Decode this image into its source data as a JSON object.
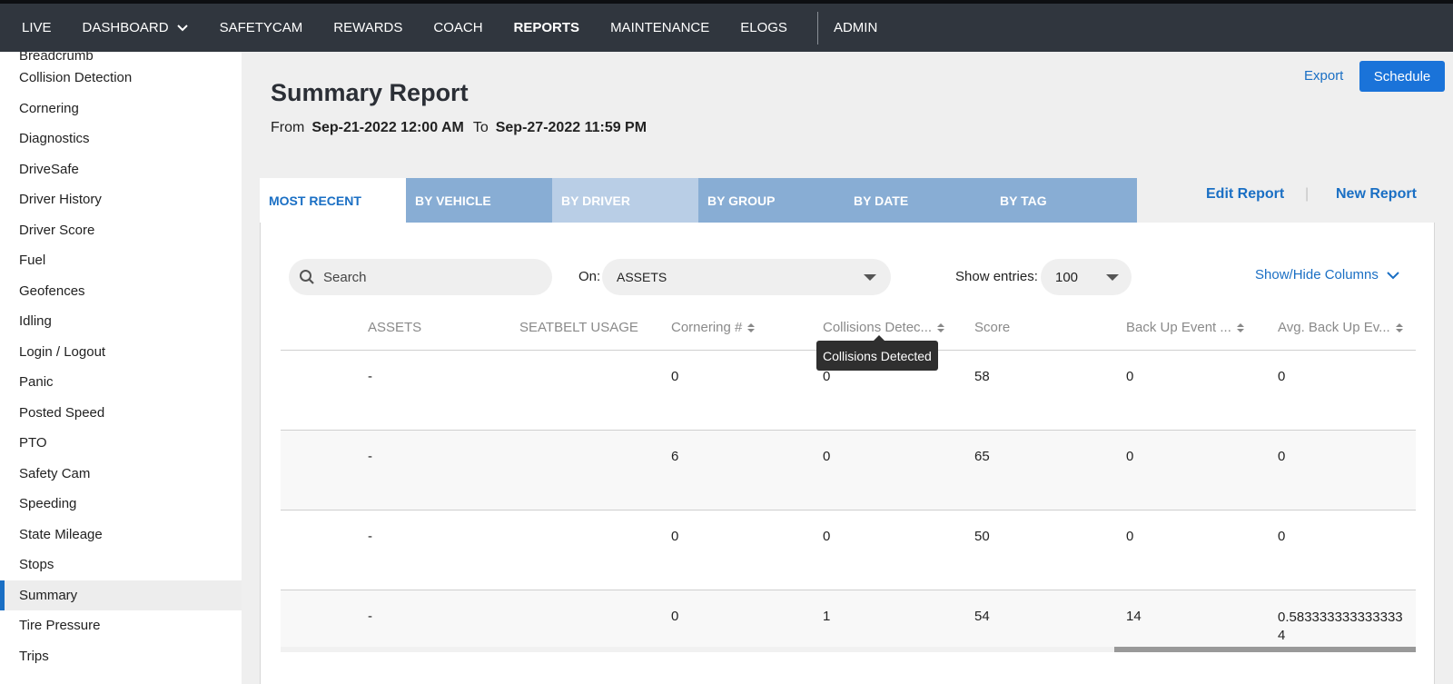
{
  "nav": {
    "items": [
      {
        "label": "LIVE"
      },
      {
        "label": "DASHBOARD"
      },
      {
        "label": "SAFETYCAM"
      },
      {
        "label": "REWARDS"
      },
      {
        "label": "COACH"
      },
      {
        "label": "REPORTS"
      },
      {
        "label": "MAINTENANCE"
      },
      {
        "label": "ELOGS"
      },
      {
        "label": "ADMIN"
      }
    ],
    "active": "REPORTS"
  },
  "sidebar": {
    "items": [
      {
        "label": "Breadcrumb"
      },
      {
        "label": "Collision Detection"
      },
      {
        "label": "Cornering"
      },
      {
        "label": "Diagnostics"
      },
      {
        "label": "DriveSafe"
      },
      {
        "label": "Driver History"
      },
      {
        "label": "Driver Score"
      },
      {
        "label": "Fuel"
      },
      {
        "label": "Geofences"
      },
      {
        "label": "Idling"
      },
      {
        "label": "Login / Logout"
      },
      {
        "label": "Panic"
      },
      {
        "label": "Posted Speed"
      },
      {
        "label": "PTO"
      },
      {
        "label": "Safety Cam"
      },
      {
        "label": "Speeding"
      },
      {
        "label": "State Mileage"
      },
      {
        "label": "Stops"
      },
      {
        "label": "Summary"
      },
      {
        "label": "Tire Pressure"
      },
      {
        "label": "Trips"
      }
    ],
    "active": "Summary"
  },
  "header": {
    "title": "Summary Report",
    "from_label": "From",
    "from_value": "Sep-21-2022 12:00 AM",
    "to_label": "To",
    "to_value": "Sep-27-2022 11:59 PM",
    "export_label": "Export",
    "schedule_label": "Schedule"
  },
  "tabs": [
    {
      "label": "MOST RECENT"
    },
    {
      "label": "BY VEHICLE"
    },
    {
      "label": "BY DRIVER"
    },
    {
      "label": "BY GROUP"
    },
    {
      "label": "BY DATE"
    },
    {
      "label": "BY TAG"
    }
  ],
  "actions": {
    "edit_report": "Edit Report",
    "separator": "|",
    "new_report": "New Report"
  },
  "filters": {
    "search_placeholder": "Search",
    "on_label": "On:",
    "on_value": "ASSETS",
    "entries_label": "Show entries:",
    "entries_value": "100",
    "show_hide_label": "Show/Hide Columns"
  },
  "table": {
    "columns": [
      {
        "label": "ASSETS"
      },
      {
        "label": "SEATBELT USAGE"
      },
      {
        "label": "Cornering #"
      },
      {
        "label": "Collisions Detec..."
      },
      {
        "label": "Score"
      },
      {
        "label": "Back Up Event ..."
      },
      {
        "label": "Avg. Back Up Ev..."
      }
    ],
    "rows": [
      {
        "assets": "-",
        "seatbelt": "",
        "cornering": "0",
        "collisions": "0",
        "score": "58",
        "backup": "0",
        "avg_backup": "0"
      },
      {
        "assets": "-",
        "seatbelt": "",
        "cornering": "6",
        "collisions": "0",
        "score": "65",
        "backup": "0",
        "avg_backup": "0"
      },
      {
        "assets": "-",
        "seatbelt": "",
        "cornering": "0",
        "collisions": "0",
        "score": "50",
        "backup": "0",
        "avg_backup": "0"
      },
      {
        "assets": "-",
        "seatbelt": "",
        "cornering": "0",
        "collisions": "1",
        "score": "54",
        "backup": "14",
        "avg_backup": "0.5833333333333334"
      }
    ]
  },
  "tooltip": {
    "text": "Collisions Detected"
  },
  "colors": {
    "nav_bg": "#30363e",
    "accent": "#1a6fc4",
    "tab_bg": "#88add4",
    "schedule_bg": "#1a73d9"
  }
}
